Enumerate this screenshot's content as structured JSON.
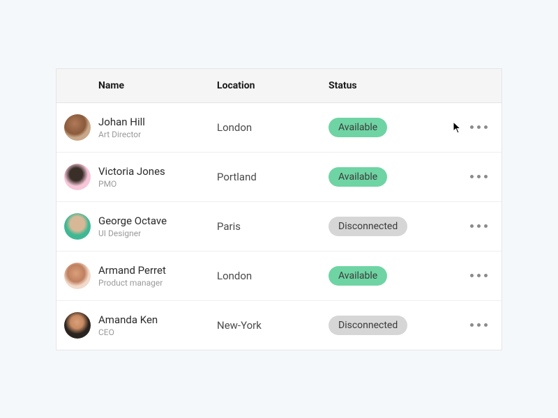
{
  "columns": {
    "name": "Name",
    "location": "Location",
    "status": "Status"
  },
  "rows": [
    {
      "name": "Johan Hill",
      "role": "Art Director",
      "location": "London",
      "status": "Available",
      "status_kind": "available"
    },
    {
      "name": "Victoria Jones",
      "role": "PMO",
      "location": "Portland",
      "status": "Available",
      "status_kind": "available"
    },
    {
      "name": "George Octave",
      "role": "UI Designer",
      "location": "Paris",
      "status": "Disconnected",
      "status_kind": "disconnected"
    },
    {
      "name": "Armand Perret",
      "role": "Product manager",
      "location": "London",
      "status": "Available",
      "status_kind": "available"
    },
    {
      "name": "Amanda Ken",
      "role": "CEO",
      "location": "New-York",
      "status": "Disconnected",
      "status_kind": "disconnected"
    }
  ]
}
